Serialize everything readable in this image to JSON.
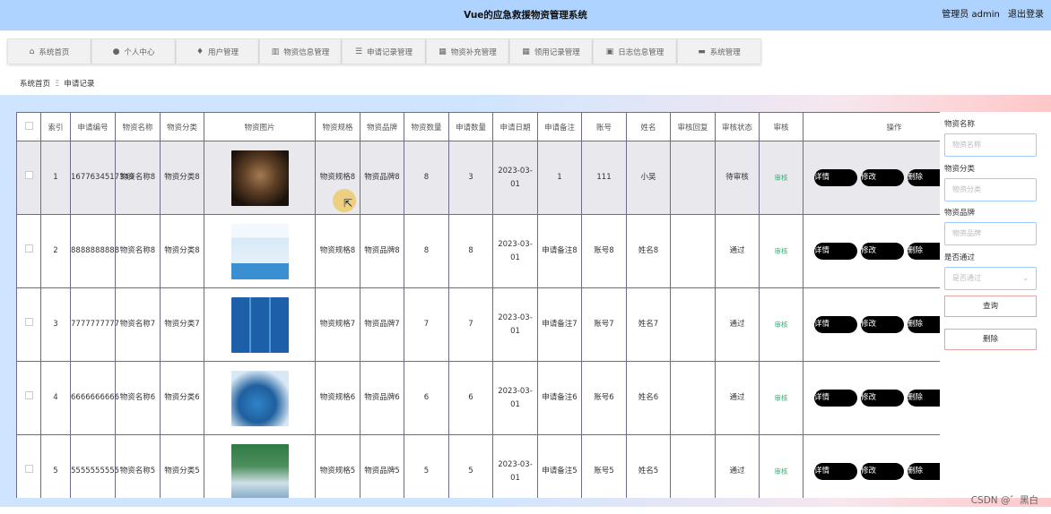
{
  "header": {
    "title": "Vue的应急救援物资管理系统",
    "user_label": "管理员 admin",
    "logout_label": "退出登录"
  },
  "nav": [
    {
      "icon": "home-icon",
      "glyph": "⌂",
      "label": "系统首页"
    },
    {
      "icon": "user-icon",
      "glyph": "●",
      "label": "个人中心"
    },
    {
      "icon": "location-icon",
      "glyph": "♦",
      "label": "用户管理"
    },
    {
      "icon": "bar-chart-icon",
      "glyph": "▥",
      "label": "物资信息管理"
    },
    {
      "icon": "list-icon",
      "glyph": "☰",
      "label": "申请记录管理"
    },
    {
      "icon": "grid-icon",
      "glyph": "▦",
      "label": "物资补充管理"
    },
    {
      "icon": "grid-icon",
      "glyph": "▦",
      "label": "领用记录管理"
    },
    {
      "icon": "calendar-icon",
      "glyph": "▣",
      "label": "日志信息管理"
    },
    {
      "icon": "briefcase-icon",
      "glyph": "▬",
      "label": "系统管理"
    }
  ],
  "breadcrumb": {
    "home": "系统首页",
    "separator": "Ξ",
    "current": "申请记录"
  },
  "table": {
    "headers": [
      "",
      "索引",
      "申请编号",
      "物资名称",
      "物资分类",
      "物资图片",
      "物资规格",
      "物资品牌",
      "物资数量",
      "申请数量",
      "申请日期",
      "申请备注",
      "账号",
      "姓名",
      "审核回复",
      "审核状态",
      "审核",
      "操作"
    ],
    "audit_label": "审核",
    "actions": {
      "detail": "详情",
      "edit": "修改",
      "delete": "删除"
    },
    "rows": [
      {
        "index": "1",
        "app_no": "1677634517349",
        "name": "物资名称8",
        "category": "物资分类8",
        "image": "dark-room-photo",
        "spec": "物资规格8",
        "brand": "物资品牌8",
        "qty": "8",
        "apply_qty": "3",
        "date": "2023-03-01",
        "remark": "1",
        "account": "111",
        "person": "小吴",
        "reply": "",
        "status": "待审核"
      },
      {
        "index": "2",
        "app_no": "8888888888",
        "name": "物资名称8",
        "category": "物资分类8",
        "image": "mask-woman-photo",
        "spec": "物资规格8",
        "brand": "物资品牌8",
        "qty": "8",
        "apply_qty": "8",
        "date": "2023-03-01",
        "remark": "申请备注8",
        "account": "账号8",
        "person": "姓名8",
        "reply": "",
        "status": "通过"
      },
      {
        "index": "3",
        "app_no": "7777777777",
        "name": "物资名称7",
        "category": "物资分类7",
        "image": "medical-grid-photo",
        "spec": "物资规格7",
        "brand": "物资品牌7",
        "qty": "7",
        "apply_qty": "7",
        "date": "2023-03-01",
        "remark": "申请备注7",
        "account": "账号7",
        "person": "姓名7",
        "reply": "",
        "status": "通过"
      },
      {
        "index": "4",
        "app_no": "6666666666",
        "name": "物资名称6",
        "category": "物资分类6",
        "image": "doctor-photo",
        "spec": "物资规格6",
        "brand": "物资品牌6",
        "qty": "6",
        "apply_qty": "6",
        "date": "2023-03-01",
        "remark": "申请备注6",
        "account": "账号6",
        "person": "姓名6",
        "reply": "",
        "status": "通过"
      },
      {
        "index": "5",
        "app_no": "5555555555",
        "name": "物资名称5",
        "category": "物资分类5",
        "image": "supplies-photo",
        "spec": "物资规格5",
        "brand": "物资品牌5",
        "qty": "5",
        "apply_qty": "5",
        "date": "2023-03-01",
        "remark": "申请备注5",
        "account": "账号5",
        "person": "姓名5",
        "reply": "",
        "status": "通过"
      }
    ]
  },
  "search": {
    "name_label": "物资名称",
    "name_placeholder": "物资名称",
    "category_label": "物资分类",
    "category_placeholder": "物资分类",
    "brand_label": "物资品牌",
    "brand_placeholder": "物资品牌",
    "pass_label": "是否通过",
    "pass_placeholder": "是否通过",
    "query_button": "查询",
    "delete_button": "删除"
  },
  "watermark": "CSDN @゛黑白"
}
